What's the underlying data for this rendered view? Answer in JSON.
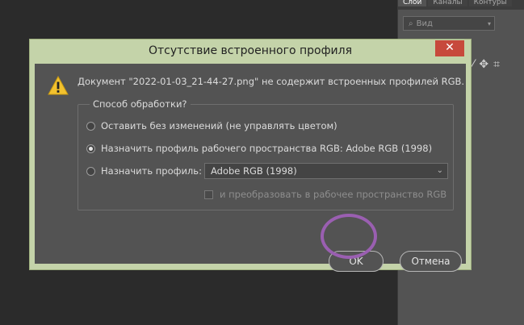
{
  "right_panel": {
    "tabs": [
      "Слои",
      "Каналы",
      "Контуры"
    ],
    "search_placeholder": "Вид"
  },
  "dialog": {
    "title": "Отсутствие встроенного профиля",
    "close_label": "✕",
    "message": "Документ \"2022-01-03_21-44-27.png\" не содержит встроенных профилей RGB.",
    "group_label": "Способ обработки?",
    "options": [
      {
        "label": "Оставить без изменений (не управлять цветом)",
        "selected": false
      },
      {
        "label": "Назначить профиль рабочего пространства RGB:  Adobe RGB (1998)",
        "selected": true
      },
      {
        "label": "Назначить профиль:",
        "selected": false
      }
    ],
    "profile_select": "Adobe RGB (1998)",
    "convert_checkbox": {
      "label": "и преобразовать в рабочее пространство RGB",
      "checked": false,
      "enabled": false
    },
    "ok_label": "OK",
    "cancel_label": "Отмена"
  },
  "colors": {
    "dialog_frame": "#c4d3a9",
    "close_button": "#c7493c",
    "highlight_ring": "#9a5fb1",
    "warning": "#f2c12e"
  }
}
